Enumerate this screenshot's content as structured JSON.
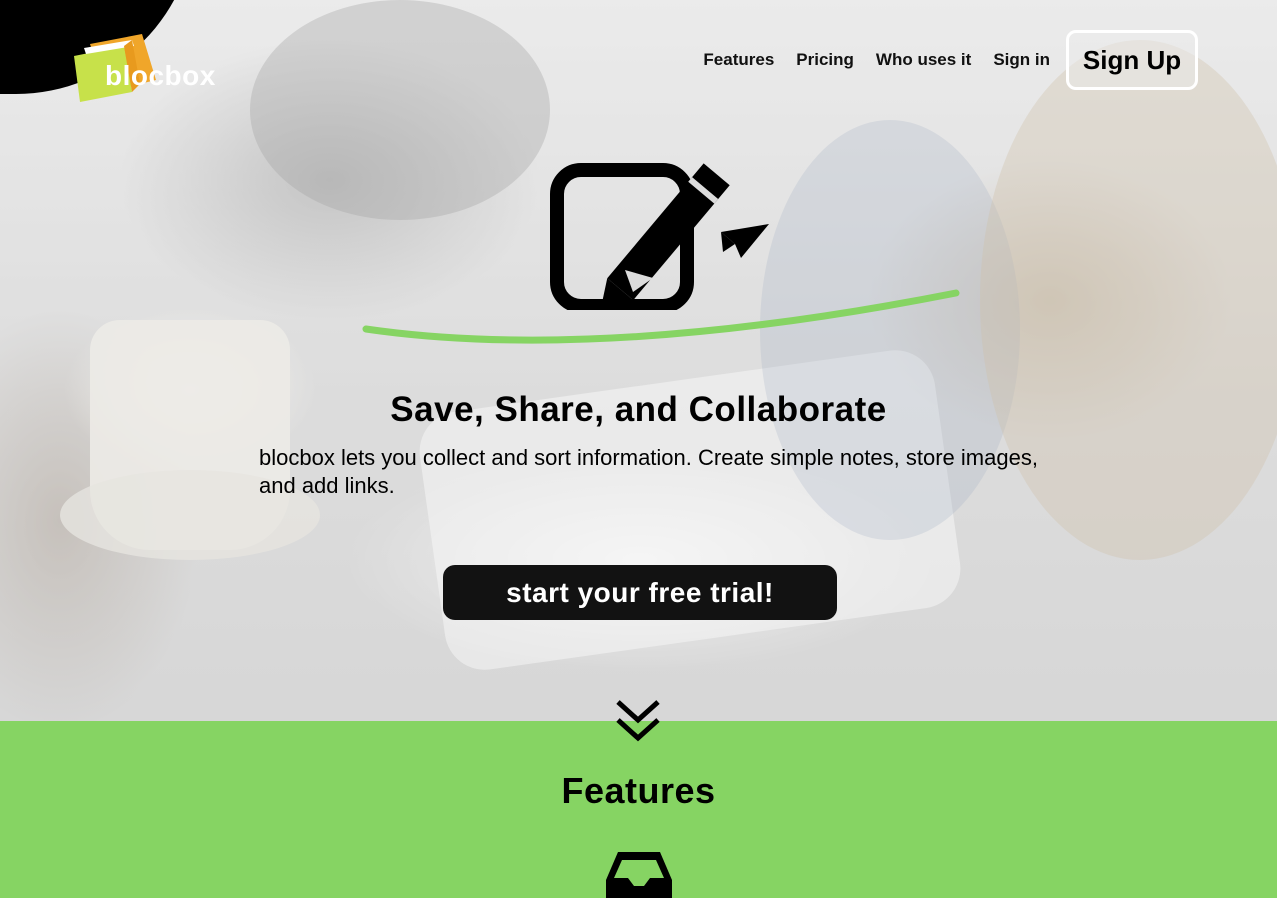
{
  "brand": {
    "name": "blocbox",
    "logo_icon": "book-icon"
  },
  "nav": {
    "items": [
      "Features",
      "Pricing",
      "Who uses it",
      "Sign in"
    ],
    "signup_label": "Sign Up"
  },
  "hero": {
    "icon": "edit-send-icon",
    "title": "Save, Share, and Collaborate",
    "description": "blocbox lets you collect and sort information. Create simple notes, store images, and add links.",
    "cta_label": "start your free trial!"
  },
  "scroll_hint_icon": "double-chevron-down-icon",
  "features": {
    "title": "Features",
    "icon": "inbox-icon"
  },
  "colors": {
    "accent_green": "#86d463",
    "dark": "#121212",
    "white": "#ffffff"
  }
}
